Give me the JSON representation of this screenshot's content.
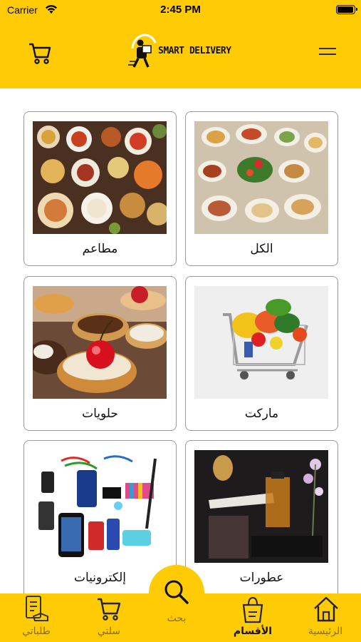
{
  "status_bar": {
    "carrier": "Carrier",
    "time": "2:45 PM"
  },
  "header": {
    "logo_text": "SMART DELIVERY"
  },
  "categories": [
    {
      "label": "مطاعم",
      "image": "restaurant-dishes-photo"
    },
    {
      "label": "الكل",
      "image": "mixed-dishes-photo"
    },
    {
      "label": "حلويات",
      "image": "tarts-desserts-photo"
    },
    {
      "label": "ماركت",
      "image": "grocery-cart-photo"
    },
    {
      "label": "إلكترونيات",
      "image": "electronics-accessories-photo"
    },
    {
      "label": "عطورات",
      "image": "perfume-bottles-photo"
    }
  ],
  "bottom_nav": {
    "my_orders": "طلباتي",
    "my_cart": "سلتي",
    "search": "بحث",
    "categories": "الأقسام",
    "home": "الرئيسية"
  },
  "colors": {
    "brand": "#FFCB05",
    "inactive_tab": "#8a6d00"
  }
}
